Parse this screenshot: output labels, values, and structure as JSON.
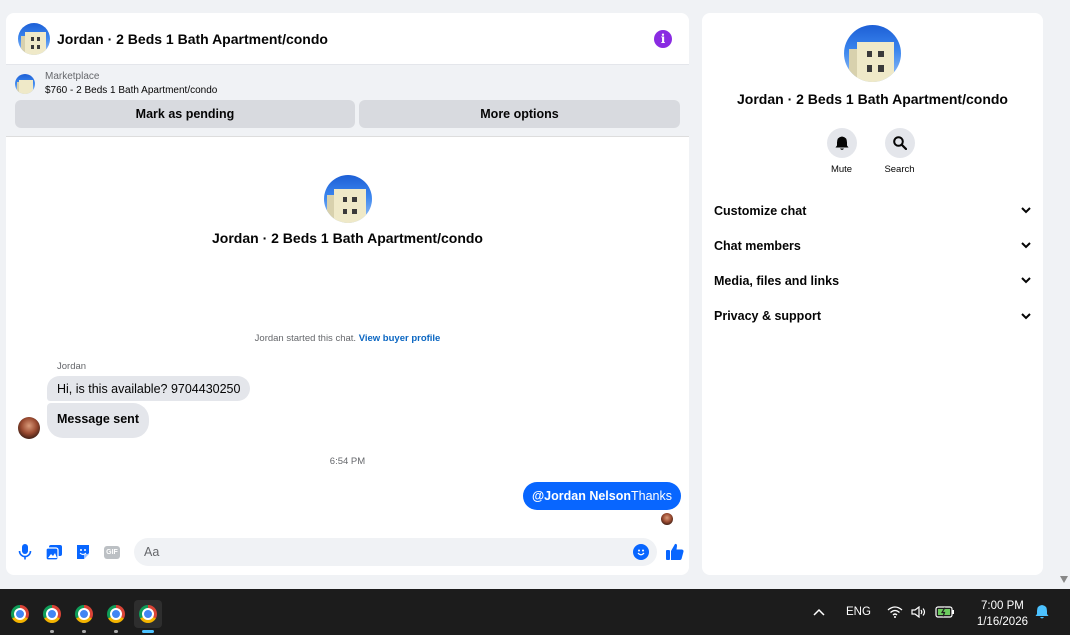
{
  "chat": {
    "title": "Jordan · 2 Beds 1 Bath Apartment/condo",
    "marketplace_label": "Marketplace",
    "listing": "$760 - 2 Beds 1 Bath Apartment/condo",
    "mark_pending_label": "Mark as pending",
    "more_options_label": "More options",
    "profile_name": "Jordan · 2 Beds 1 Bath Apartment/condo",
    "started_text": "Jordan started this chat.",
    "buyer_profile_link": "View buyer profile",
    "sender_name": "Jordan",
    "messages_in": [
      "Hi, is this available? 9704430250",
      "Message sent"
    ],
    "timestamp": "6:54 PM",
    "message_out_mention": "@Jordan Nelson",
    "message_out_text": "Thanks",
    "composer_placeholder": "Aa"
  },
  "details": {
    "name": "Jordan · 2 Beds 1 Bath Apartment/condo",
    "mute_label": "Mute",
    "search_label": "Search",
    "sections": [
      "Customize chat",
      "Chat members",
      "Media, files and links",
      "Privacy & support"
    ]
  },
  "taskbar": {
    "language": "ENG",
    "time": "7:00 PM",
    "date": "1/16/2026"
  },
  "colors": {
    "accent": "#0866ff",
    "info": "#8a2be2"
  }
}
